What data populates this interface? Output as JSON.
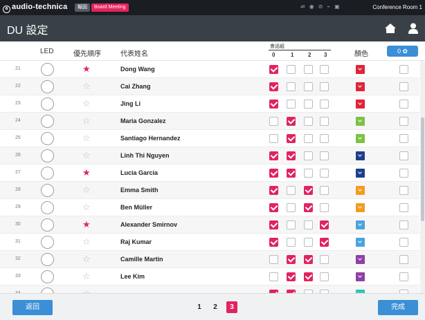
{
  "brand": {
    "name": "audio-technica",
    "mark": "a"
  },
  "meeting": {
    "tag": "報図",
    "name": "Board Meeting"
  },
  "room": "Conference Room 1",
  "page": {
    "title": "DU 設定"
  },
  "columns": {
    "led": "LED",
    "priority": "優先順序",
    "name": "代表姓名",
    "group_title": "會話組",
    "groups": [
      "0",
      "1",
      "2",
      "3"
    ],
    "color": "顏色"
  },
  "count_button": {
    "label": "0"
  },
  "rows": [
    {
      "num": "21",
      "name": "Dong Wang",
      "priority": true,
      "groups": [
        true,
        false,
        false,
        false
      ],
      "color": "#e0233a"
    },
    {
      "num": "22",
      "name": "Cai Zhang",
      "priority": false,
      "groups": [
        true,
        false,
        false,
        false
      ],
      "color": "#e0233a"
    },
    {
      "num": "23",
      "name": "Jing Li",
      "priority": false,
      "groups": [
        true,
        false,
        false,
        false
      ],
      "color": "#e0233a"
    },
    {
      "num": "24",
      "name": "Maria Gonzalez",
      "priority": false,
      "groups": [
        false,
        true,
        false,
        false
      ],
      "color": "#7cc242"
    },
    {
      "num": "25",
      "name": "Santiago Hernandez",
      "priority": false,
      "groups": [
        false,
        true,
        false,
        false
      ],
      "color": "#7cc242"
    },
    {
      "num": "26",
      "name": "Linh Thi Nguyen",
      "priority": false,
      "groups": [
        true,
        true,
        false,
        false
      ],
      "color": "#1f3f8a"
    },
    {
      "num": "27",
      "name": "Lucia Garcia",
      "priority": true,
      "groups": [
        true,
        true,
        false,
        false
      ],
      "color": "#1f3f8a"
    },
    {
      "num": "28",
      "name": "Emma Smith",
      "priority": false,
      "groups": [
        true,
        false,
        true,
        false
      ],
      "color": "#f39c1e"
    },
    {
      "num": "29",
      "name": "Ben Müller",
      "priority": false,
      "groups": [
        true,
        false,
        true,
        false
      ],
      "color": "#f39c1e"
    },
    {
      "num": "30",
      "name": "Alexander Smirnov",
      "priority": true,
      "groups": [
        true,
        false,
        false,
        true
      ],
      "color": "#4aa3de"
    },
    {
      "num": "31",
      "name": "Raj Kumar",
      "priority": false,
      "groups": [
        true,
        false,
        false,
        true
      ],
      "color": "#4aa3de"
    },
    {
      "num": "32",
      "name": "Camille Martin",
      "priority": false,
      "groups": [
        false,
        true,
        true,
        false
      ],
      "color": "#8e3fa6"
    },
    {
      "num": "33",
      "name": "Lee Kim",
      "priority": false,
      "groups": [
        false,
        true,
        true,
        false
      ],
      "color": "#8e3fa6"
    },
    {
      "num": "34",
      "name": "",
      "priority": false,
      "groups": [
        true,
        true,
        false,
        false
      ],
      "color": "#2ec4b6"
    }
  ],
  "footer": {
    "back_label": "返回",
    "done_label": "完成",
    "pages": [
      "1",
      "2",
      "3"
    ],
    "current_page": "3"
  }
}
